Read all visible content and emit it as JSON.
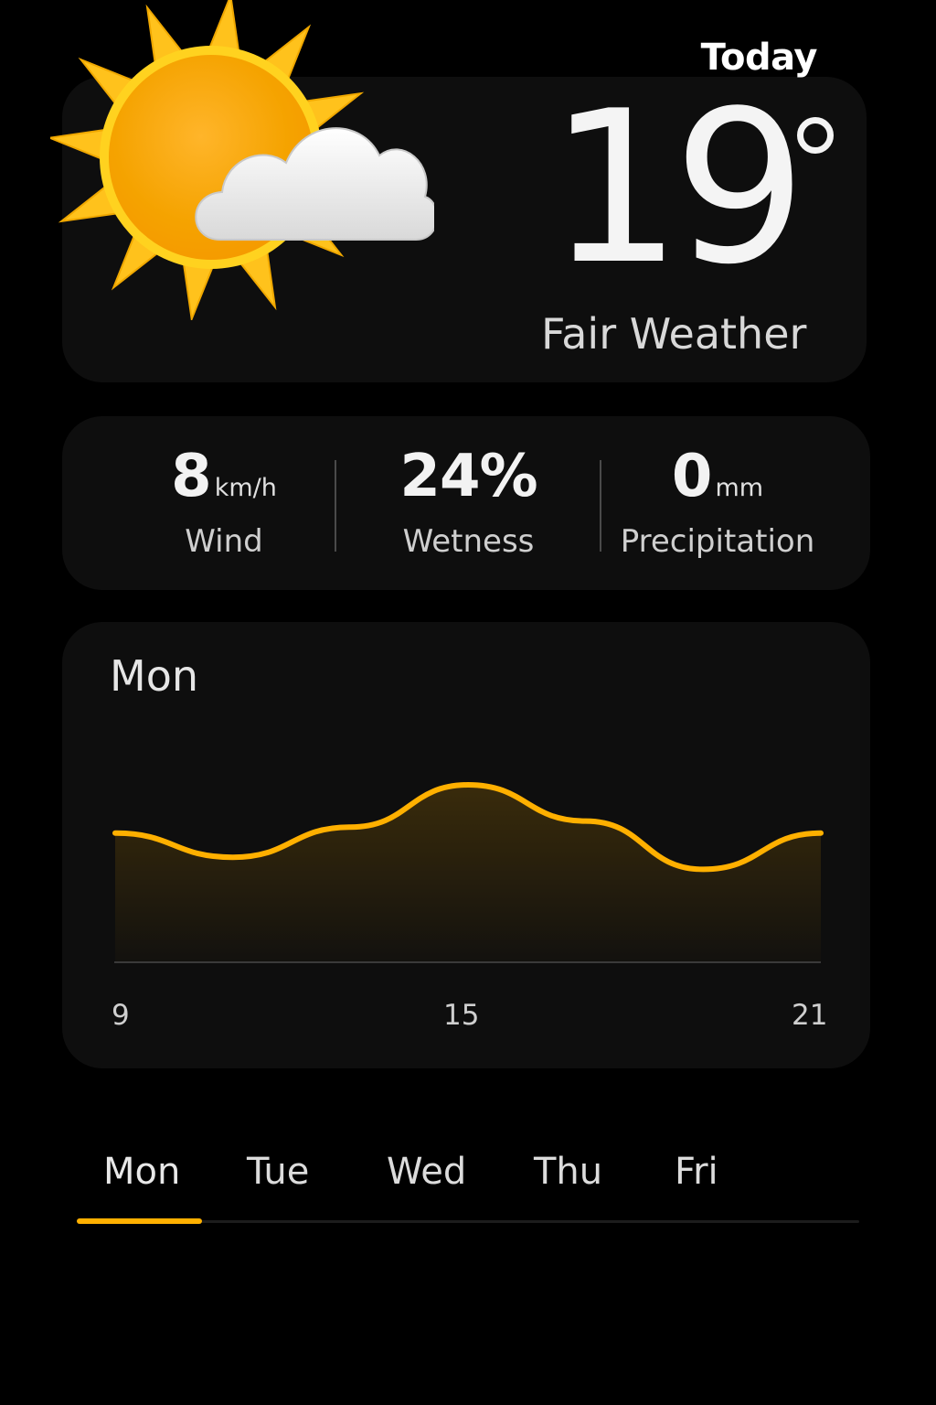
{
  "header": {
    "label": "Today"
  },
  "current": {
    "temperature": "19",
    "condition": "Fair Weather",
    "icon": "sun-behind-cloud-icon"
  },
  "stats": [
    {
      "value": "8",
      "unit": "km/h",
      "label": "Wind"
    },
    {
      "value": "24%",
      "unit": "",
      "label": "Wetness"
    },
    {
      "value": "0",
      "unit": "mm",
      "label": "Precipitation"
    }
  ],
  "forecast_chart": {
    "day": "Mon",
    "x_ticks": [
      "9",
      "15",
      "21"
    ]
  },
  "chart_data": {
    "type": "area",
    "title": "Mon",
    "x": [
      9,
      11,
      13,
      15,
      17,
      19,
      21
    ],
    "values": [
      0.6,
      0.4,
      0.65,
      1.0,
      0.7,
      0.3,
      0.6
    ],
    "xlim": [
      9,
      21
    ],
    "x_tick_labels": [
      "9",
      "15",
      "21"
    ],
    "grid": false,
    "color": "#ffb000"
  },
  "day_tabs": [
    {
      "label": "Mon",
      "selected": true
    },
    {
      "label": "Tue",
      "selected": false
    },
    {
      "label": "Wed",
      "selected": false
    },
    {
      "label": "Thu",
      "selected": false
    },
    {
      "label": "Fri",
      "selected": false
    }
  ],
  "colors": {
    "accent": "#ffb000",
    "background": "#000000",
    "card": "#0e0e0e"
  }
}
